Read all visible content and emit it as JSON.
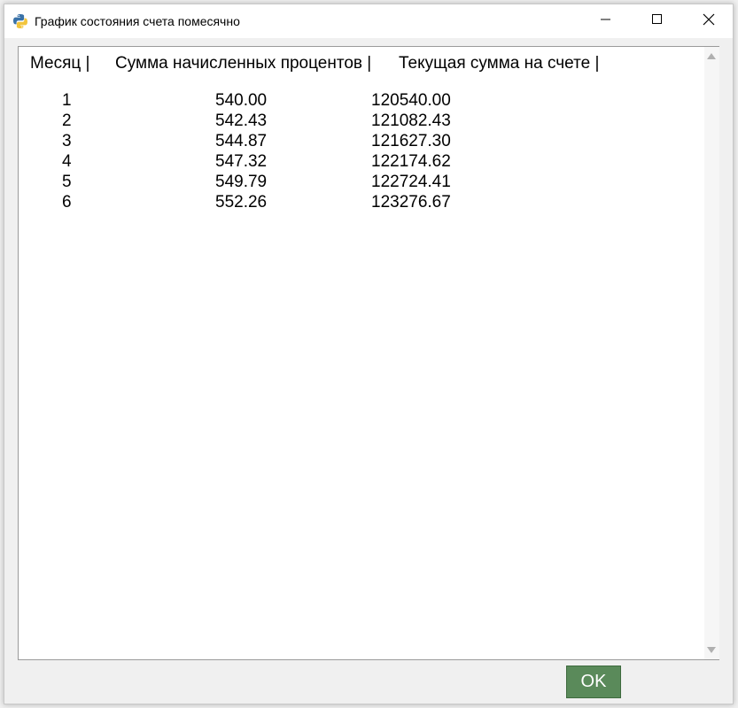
{
  "window": {
    "title": "График состояния счета помесячно",
    "icon": "python-icon"
  },
  "controls": {
    "minimize_icon": "minimize-icon",
    "maximize_icon": "maximize-icon",
    "close_icon": "close-icon"
  },
  "table": {
    "headers": {
      "month": "Месяц |",
      "interest": "Сумма начисленных процентов |",
      "balance": "Текущая сумма на счете |"
    },
    "rows": [
      {
        "month": "1",
        "interest": "540.00",
        "balance": "120540.00"
      },
      {
        "month": "2",
        "interest": "542.43",
        "balance": "121082.43"
      },
      {
        "month": "3",
        "interest": "544.87",
        "balance": "121627.30"
      },
      {
        "month": "4",
        "interest": "547.32",
        "balance": "122174.62"
      },
      {
        "month": "5",
        "interest": "549.79",
        "balance": "122724.41"
      },
      {
        "month": "6",
        "interest": "552.26",
        "balance": "123276.67"
      }
    ]
  },
  "footer": {
    "ok_label": "OK"
  },
  "colors": {
    "ok_button": "#5a8a5a",
    "text": "#000000",
    "background": "#f0f0f0"
  }
}
